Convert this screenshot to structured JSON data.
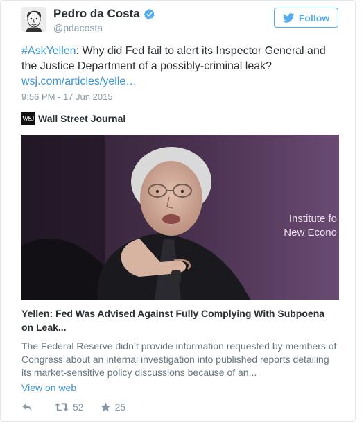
{
  "author": {
    "name": "Pedro da Costa",
    "handle": "@pdacosta",
    "verified": true
  },
  "follow_button": {
    "label": "Follow",
    "icon": "twitter-bird-icon"
  },
  "tweet": {
    "hashtag": "#AskYellen",
    "text": ": Why did Fed fail to alert its Inspector General and the Justice Department of a possibly-criminal leak?",
    "link_text": "wsj.com/articles/yelle…",
    "timestamp": "9:56 PM - 17 Jun 2015"
  },
  "card": {
    "source_logo": "WSJ",
    "source_name": "Wall Street Journal",
    "title": "Yellen: Fed Was Advised Against Fully Complying With Subpoena on Leak...",
    "description": "The Federal Reserve didn’t provide information requested by members of Congress about an internal investigation into published reports detailing its market-sensitive policy discussions because of an...",
    "image_caption_text": "Institute fo New Econo"
  },
  "view_on_web": "View on web",
  "actions": {
    "reply_icon": "reply-icon",
    "retweet_icon": "retweet-icon",
    "retweet_count": "52",
    "favorite_icon": "star-icon",
    "favorite_count": "25"
  },
  "colors": {
    "link": "#3b94d9",
    "follow": "#55acee",
    "muted": "#8899a6",
    "text": "#292f33"
  }
}
